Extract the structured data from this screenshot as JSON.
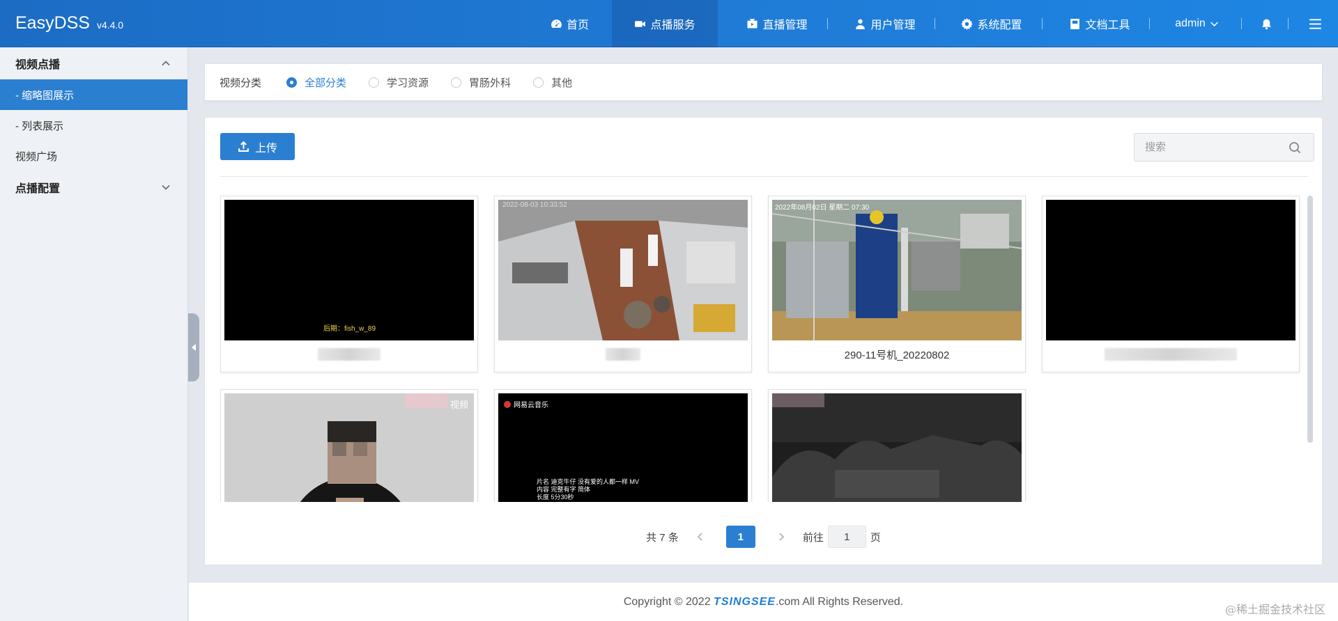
{
  "app": {
    "name": "EasyDSS",
    "version": "v4.4.0"
  },
  "nav": {
    "home": "首页",
    "vod": "点播服务",
    "live": "直播管理",
    "users": "用户管理",
    "settings": "系统配置",
    "docs": "文档工具",
    "admin": "admin"
  },
  "sidebar": {
    "group_vod": "视频点播",
    "item_thumbs": "- 缩略图展示",
    "item_list": "- 列表展示",
    "item_square": "视频广场",
    "group_config": "点播配置"
  },
  "filter": {
    "label": "视频分类",
    "options": [
      "全部分类",
      "学习资源",
      "胃肠外科",
      "其他"
    ],
    "selected": "全部分类"
  },
  "toolbar": {
    "upload": "上传",
    "search_placeholder": "搜索"
  },
  "videos": [
    {
      "title": "",
      "overlay": "后期：fish_w_89"
    },
    {
      "title": "",
      "overlay": "2022-08-03 10:33:52"
    },
    {
      "title": "290-11号机_20220802",
      "overlay": "2022年08月02日 星期二 07:30"
    },
    {
      "title": "",
      "overlay": ""
    },
    {
      "title": "",
      "overlay": "视频"
    },
    {
      "title": "",
      "overlay": "网易云音乐",
      "credits": [
        "片名 迪克牛仔 没有爱的人都一样 MV",
        "内容 完整有字 简体",
        "长度 5分30秒"
      ]
    },
    {
      "title": "",
      "overlay": ""
    }
  ],
  "pagination": {
    "total": "共 7 条",
    "current": "1",
    "goto_label": "前往",
    "goto_value": "1",
    "page_suffix": "页"
  },
  "footer": {
    "prefix": "Copyright © 2022 ",
    "brand": "TSINGSEE",
    "suffix": ".com All Rights Reserved."
  },
  "watermark": "@稀土掘金技术社区",
  "colors": {
    "primary": "#2b7fd0",
    "topbar": "#1f7bd6"
  }
}
